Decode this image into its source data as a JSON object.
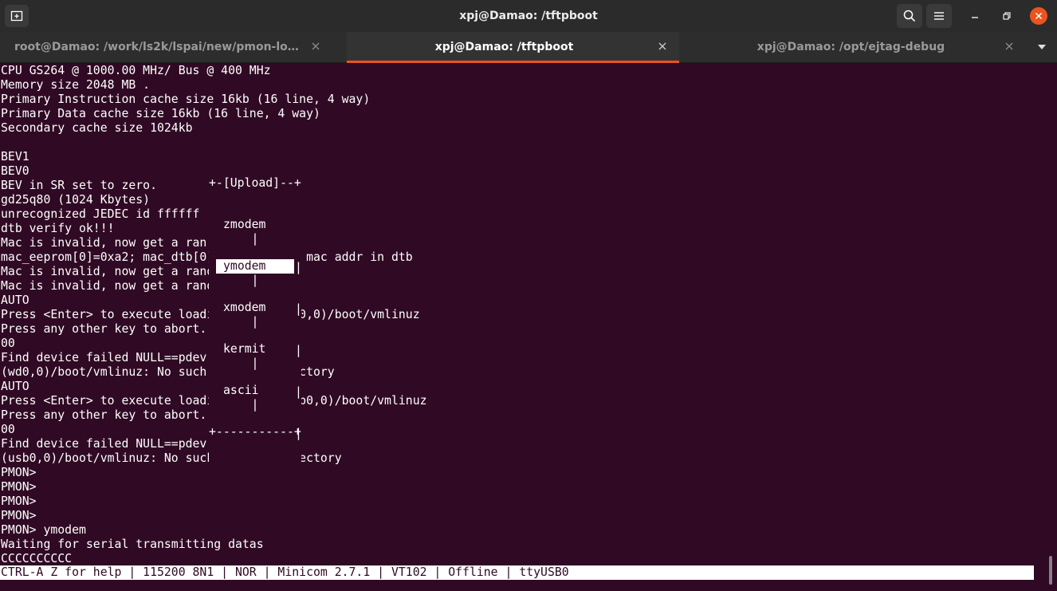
{
  "window": {
    "title": "xpj@Damao: /tftpboot"
  },
  "icons": {
    "new_tab": "new-tab-icon",
    "search": "search-icon",
    "menu": "hamburger-menu-icon",
    "minimize": "minimize-icon",
    "maximize": "maximize-icon",
    "close": "close-icon",
    "tab_dropdown": "chevron-down-icon"
  },
  "colors": {
    "terminal_bg": "#300a24",
    "accent": "#e95420",
    "titlebar_bg": "#2b2b2b"
  },
  "tabs": [
    {
      "label": "root@Damao: /work/ls2k/lspai/new/pmon-loong...",
      "active": false
    },
    {
      "label": "xpj@Damao: /tftpboot",
      "active": true
    },
    {
      "label": "xpj@Damao: /opt/ejtag-debug",
      "active": false
    }
  ],
  "terminal": {
    "lines": [
      "CPU GS264 @ 1000.00 MHz/ Bus @ 400 MHz",
      "Memory size 2048 MB .",
      "Primary Instruction cache size 16kb (16 line, 4 way)",
      "Primary Data cache size 16kb (16 line, 4 way)",
      "Secondary cache size 1024kb",
      "",
      "BEV1",
      "BEV0",
      "BEV in SR set to zero.",
      "gd25q80 (1024 Kbytes)",
      "unrecognized JEDEC id ffffff",
      "dtb verify ok!!!",
      "Mac is invalid, now get a ran",
      "mac_eeprom[0]=0xa2; mac_dtb[0]=0x64; reset mac addr in dtb",
      "Mac is invalid, now get a random mac",
      "Mac is invalid, now get a random mac",
      "AUTO",
      "Press <Enter> to execute loading image:(wd0,0)/boot/vmlinuz",
      "Press any other key to abort.",
      "00",
      "Find device failed NULL==pdev.",
      "(wd0,0)/boot/vmlinuz: No such file or directory",
      "AUTO",
      "Press <Enter> to execute loading image:(usb0,0)/boot/vmlinuz",
      "Press any other key to abort.",
      "00",
      "Find device failed NULL==pdev.",
      "(usb0,0)/boot/vmlinuz: No such file or directory",
      "PMON>",
      "PMON>",
      "PMON>",
      "PMON>",
      "PMON> ymodem",
      "Waiting for serial transmitting datas",
      "CCCCCCCCCC"
    ],
    "status_line": "CTRL-A Z for help | 115200 8N1 | NOR | Minicom 2.7.1 | VT102 | Offline | ttyUSB0"
  },
  "upload_menu": {
    "top_border": "+-[Upload]--+",
    "bottom_border": "+-----------+",
    "left_border": "|",
    "right_border": "|",
    "items": [
      "zmodem",
      "ymodem",
      "xmodem",
      "kermit",
      "ascii"
    ],
    "selected": "ymodem"
  }
}
